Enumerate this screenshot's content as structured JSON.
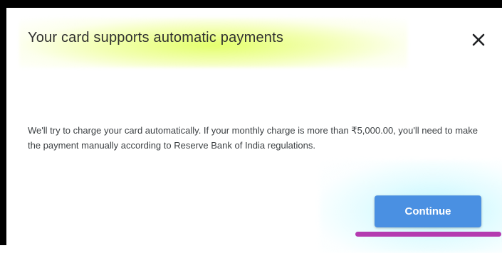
{
  "dialog": {
    "title": "Your card supports automatic payments",
    "message": "We'll try to charge your card automatically. If your monthly charge is more than ₹5,000.00, you'll need to make the payment manually according to Reserve Bank of India regulations.",
    "continue_label": "Continue",
    "close_icon": "close-icon"
  },
  "colors": {
    "frame_border": "#000000",
    "primary_button": "#4a90e2",
    "title_text": "#303030",
    "body_text": "#3c4043",
    "title_highlight": "#e2ff64",
    "button_highlight": "#b4f5ff",
    "underline_mark": "#b43bb0"
  }
}
